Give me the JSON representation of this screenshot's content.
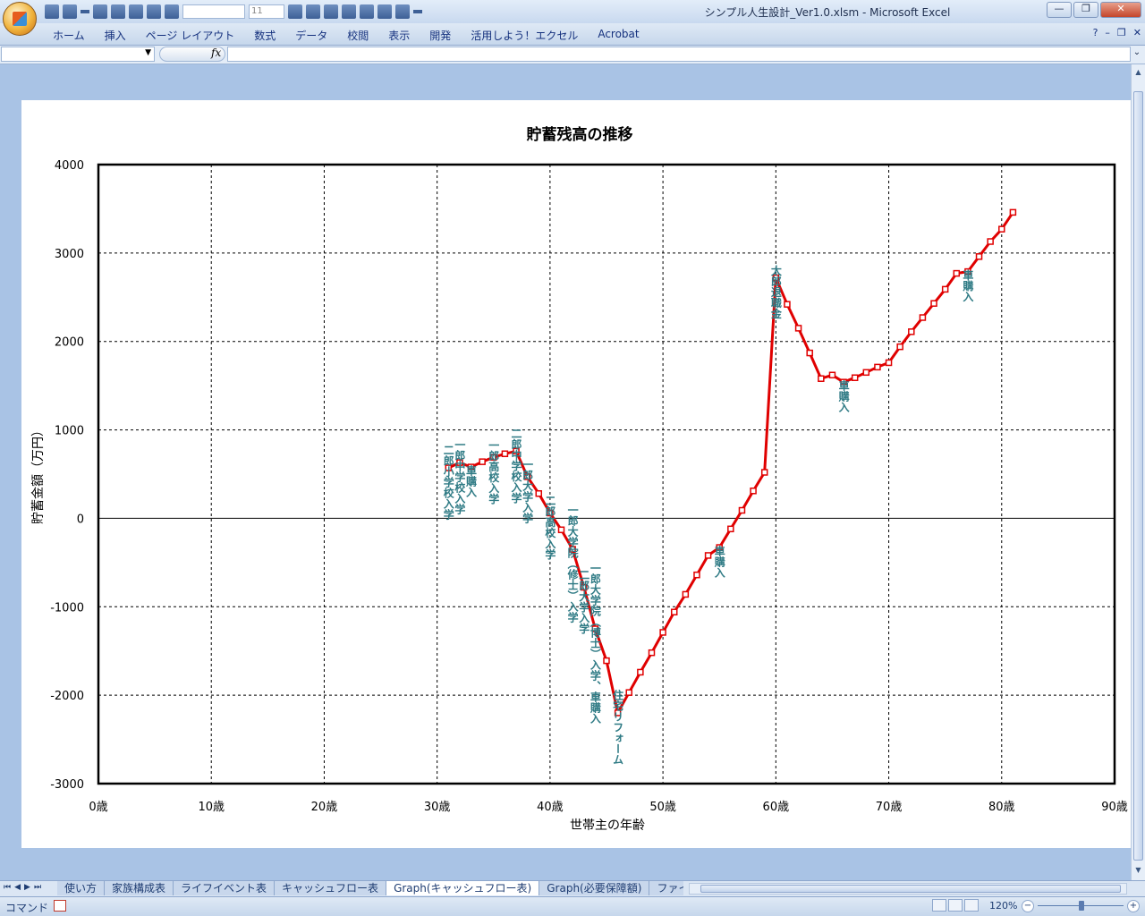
{
  "window": {
    "title": "シンプル人生設計_Ver1.0.xlsm - Microsoft Excel",
    "font_size_value": "11",
    "controls": {
      "minimize": "—",
      "restore": "❐",
      "close": "✕"
    }
  },
  "ribbon": {
    "tabs": [
      "ホーム",
      "挿入",
      "ページ レイアウト",
      "数式",
      "データ",
      "校閲",
      "表示",
      "開発",
      "活用しよう！エクセル",
      "Acrobat"
    ],
    "right_icons": [
      "help-icon",
      "minimize-icon",
      "restore-icon",
      "close-icon"
    ]
  },
  "formula_bar": {
    "fx_label": "fx",
    "name_box": "",
    "formula": ""
  },
  "sheet_tabs": {
    "tabs": [
      "使い方",
      "家族構成表",
      "ライフイベント表",
      "キャッシュフロー表",
      "Graph(キャッシュフロー表)",
      "Graph(必要保障額)",
      "ファイナン"
    ],
    "active": "Graph(キャッシュフロー表)",
    "nav": [
      "⏮",
      "◀",
      "▶",
      "⏭"
    ]
  },
  "status_bar": {
    "mode": "コマンド",
    "zoom": "120%",
    "zoom_minus": "−",
    "zoom_plus": "+"
  },
  "colors": {
    "series": "#e00000",
    "label": "#2e7a84",
    "titlebar": "#c8d9ef",
    "workspace": "#a9c3e5"
  },
  "chart_data": {
    "type": "line",
    "title": "貯蓄残高の推移",
    "xlabel": "世帯主の年齢",
    "ylabel": "貯蓄金額（万円）",
    "xlim": [
      0,
      90
    ],
    "ylim": [
      -3000,
      4000
    ],
    "x_ticks": [
      0,
      10,
      20,
      30,
      40,
      50,
      60,
      70,
      80,
      90
    ],
    "x_tick_labels": [
      "0歳",
      "10歳",
      "20歳",
      "30歳",
      "40歳",
      "50歳",
      "60歳",
      "70歳",
      "80歳",
      "90歳"
    ],
    "y_ticks": [
      4000,
      3000,
      2000,
      1000,
      0,
      -1000,
      -2000,
      -3000
    ],
    "y_tick_labels": [
      "4000",
      "3000",
      "2000",
      "1000",
      "0",
      "-1000",
      "-2000",
      "-3000"
    ],
    "grid": true,
    "series": [
      {
        "x": [
          31,
          32,
          33,
          34,
          35,
          36,
          37,
          38,
          39,
          40,
          41,
          42,
          43,
          44,
          45,
          46,
          47,
          48,
          49,
          50,
          51,
          52,
          53,
          54,
          55,
          56,
          57,
          58,
          59,
          60,
          61,
          62,
          63,
          64,
          65,
          66,
          67,
          68,
          69,
          70,
          71,
          72,
          73,
          74,
          75,
          76,
          77,
          78,
          79,
          80,
          81
        ],
        "values": [
          570,
          630,
          580,
          640,
          690,
          730,
          760,
          470,
          280,
          60,
          -130,
          -350,
          -780,
          -1250,
          -1610,
          -2200,
          -1970,
          -1740,
          -1520,
          -1290,
          -1060,
          -860,
          -640,
          -420,
          -330,
          -120,
          90,
          310,
          520,
          2720,
          2420,
          2150,
          1870,
          1580,
          1620,
          1540,
          1590,
          1650,
          1710,
          1760,
          1940,
          2110,
          2270,
          2430,
          2590,
          2770,
          2790,
          2960,
          3130,
          3270,
          3460
        ]
      }
    ],
    "annotations": [
      {
        "text": "二郎小学校入学",
        "x": 31,
        "y": 570
      },
      {
        "text": "一郎中学校入学",
        "x": 32,
        "y": 630
      },
      {
        "text": "車購入",
        "x": 33,
        "y": 580
      },
      {
        "text": "一郎高校入学",
        "x": 35,
        "y": 690
      },
      {
        "text": "二郎中学校入学",
        "x": 37,
        "y": 760
      },
      {
        "text": "一郎大学入学",
        "x": 38,
        "y": 470
      },
      {
        "text": "二郎高校入学",
        "x": 40,
        "y": 60
      },
      {
        "text": "一郎大学院（修士）入学",
        "x": 42,
        "y": -350
      },
      {
        "text": "二郎大学入学",
        "x": 43,
        "y": -780
      },
      {
        "text": "一郎大学院（博士）入学、車購入",
        "x": 44,
        "y": -1250
      },
      {
        "text": "住宅リフォーム",
        "x": 46,
        "y": -2200
      },
      {
        "text": "車購入",
        "x": 55,
        "y": -330
      },
      {
        "text": "太郎退職金",
        "x": 60,
        "y": 2720
      },
      {
        "text": "車購入",
        "x": 66,
        "y": 1540
      },
      {
        "text": "車購入",
        "x": 77,
        "y": 2790
      }
    ]
  }
}
